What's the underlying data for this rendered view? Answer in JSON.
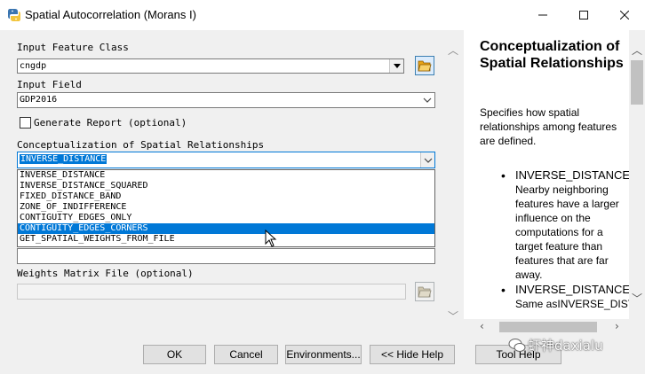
{
  "window": {
    "title": "Spatial Autocorrelation (Morans I)",
    "icon": "python-tool-icon",
    "controls": {
      "minimize": "—",
      "maximize": "☐",
      "close": "✕"
    }
  },
  "form": {
    "input_feature_class": {
      "label": "Input Feature Class",
      "value": "cngdp"
    },
    "input_field": {
      "label": "Input Field",
      "value": "GDP2016"
    },
    "generate_report": {
      "label": "Generate Report (optional)",
      "checked": false
    },
    "conceptualization": {
      "label": "Conceptualization of Spatial Relationships",
      "value": "INVERSE_DISTANCE",
      "options": [
        "INVERSE_DISTANCE",
        "INVERSE_DISTANCE_SQUARED",
        "FIXED_DISTANCE_BAND",
        "ZONE_OF_INDIFFERENCE",
        "CONTIGUITY_EDGES_ONLY",
        "CONTIGUITY_EDGES_CORNERS",
        "GET_SPATIAL_WEIGHTS_FROM_FILE"
      ],
      "highlighted_index": 5
    },
    "weights_matrix_file": {
      "label": "Weights Matrix File (optional)",
      "value": ""
    }
  },
  "help": {
    "title": "Conceptualization of Spatial Relationships",
    "intro": "Specifies how spatial relationships among features are defined.",
    "items": [
      {
        "name": "INVERSE_DISTANCE",
        "desc": "Nearby neighboring features have a larger influence on the computations for a target feature than features that are far away."
      },
      {
        "name": "INVERSE_DISTANCE",
        "desc": "Same asINVERSE_DISTANC"
      }
    ]
  },
  "buttons": {
    "ok": "OK",
    "cancel": "Cancel",
    "environments": "Environments...",
    "hide_help": "<< Hide Help",
    "tool_help": "Tool Help"
  },
  "watermark": "虾神daxialu",
  "colors": {
    "selection": "#0078d7",
    "folder_accent": "#e8a317"
  }
}
